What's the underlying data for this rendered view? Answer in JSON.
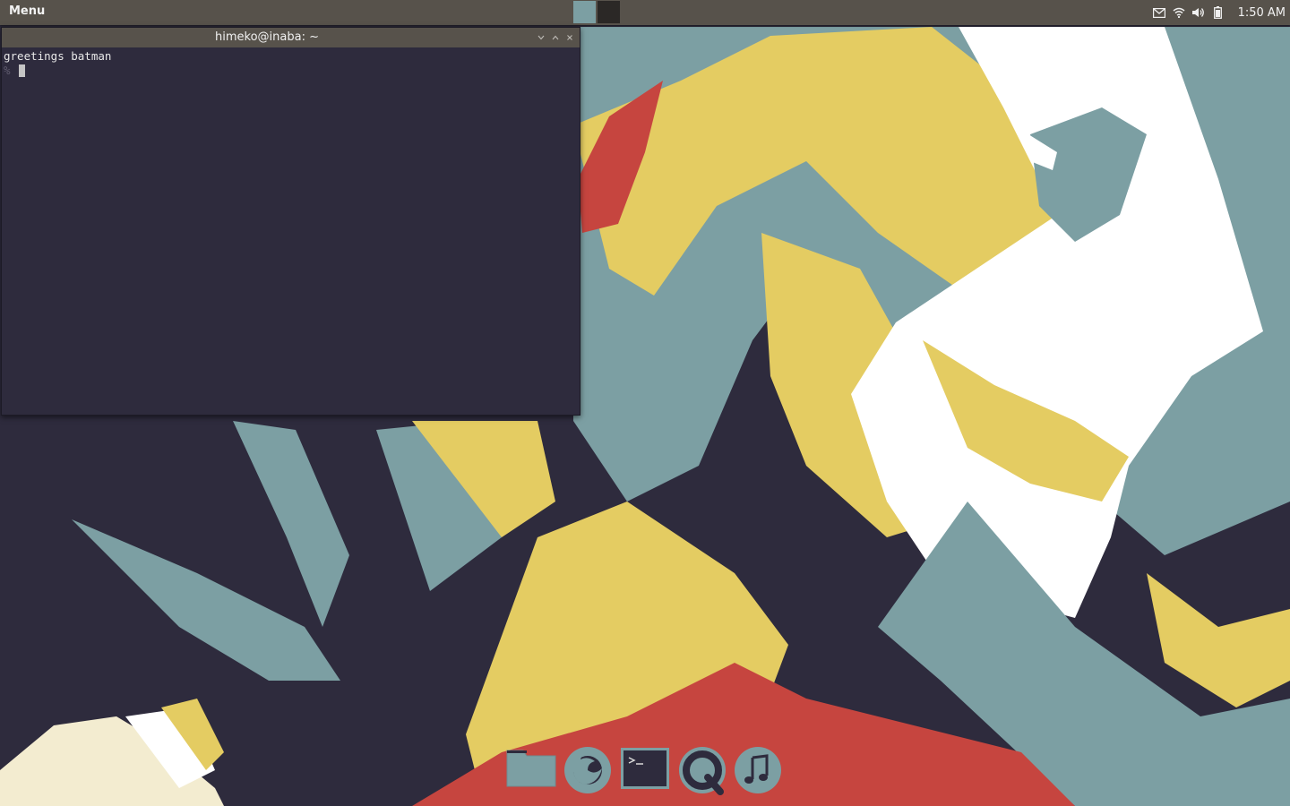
{
  "panel": {
    "menu_label": "Menu",
    "clock": "1:50 AM",
    "workspaces": [
      "workspace-1",
      "workspace-2"
    ],
    "tray_icons": [
      "mail-icon",
      "wifi-icon",
      "volume-icon",
      "battery-icon"
    ]
  },
  "terminal": {
    "title": "himeko@inaba: ~",
    "lines": [
      "greetings batman"
    ],
    "prompt": "%"
  },
  "dock": {
    "items": [
      "files-icon",
      "firefox-icon",
      "terminal-icon",
      "quicktime-icon",
      "music-icon"
    ]
  },
  "colors": {
    "panel": "#57524b",
    "terminal_bg": "#2e2b3d",
    "teal": "#7c9fa3",
    "yellow": "#e4cc62",
    "red": "#c6453f",
    "white": "#ffffff"
  }
}
